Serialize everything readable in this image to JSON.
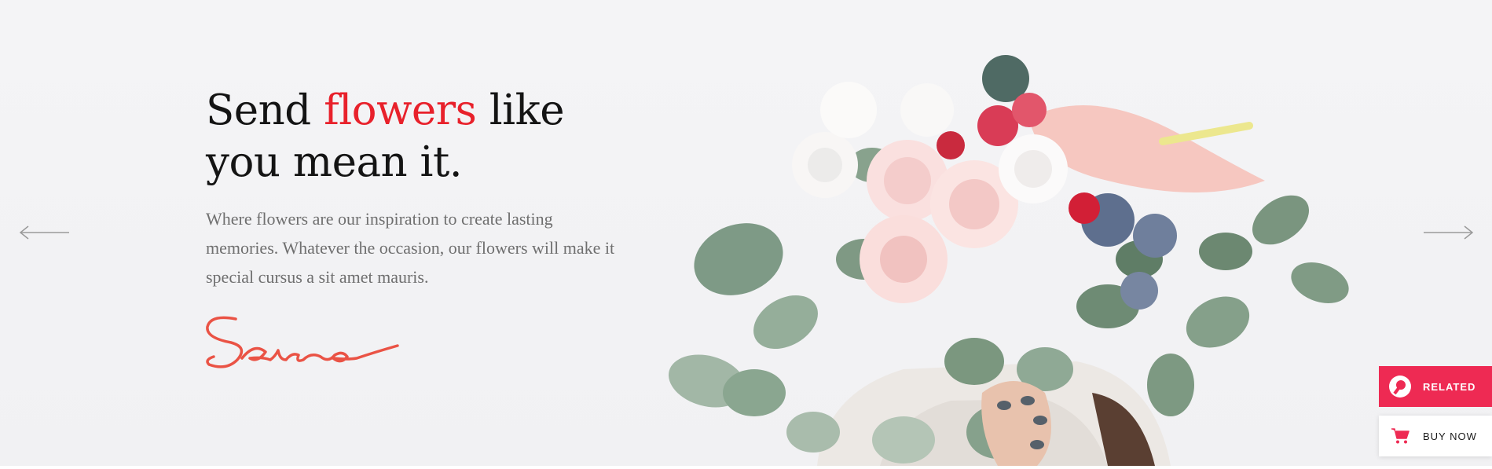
{
  "hero": {
    "headline_part1": "Send ",
    "headline_accent": "flowers",
    "headline_part2": " like",
    "headline_line2": "you mean it.",
    "subtext": "Where flowers are our inspiration to create lasting memories. Whatever the occasion, our flowers will make it special cursus a sit amet mauris.",
    "signature": "Sara",
    "accent_color": "#e8212b",
    "signature_color": "#ea5345"
  },
  "slider": {
    "prev_icon": "arrow-left-icon",
    "next_icon": "arrow-right-icon"
  },
  "side_buttons": {
    "related_label": "RELATED",
    "related_icon": "related-logo-icon",
    "buy_label": "BUY NOW",
    "buy_icon": "cart-icon",
    "related_color": "#ee2a53"
  }
}
